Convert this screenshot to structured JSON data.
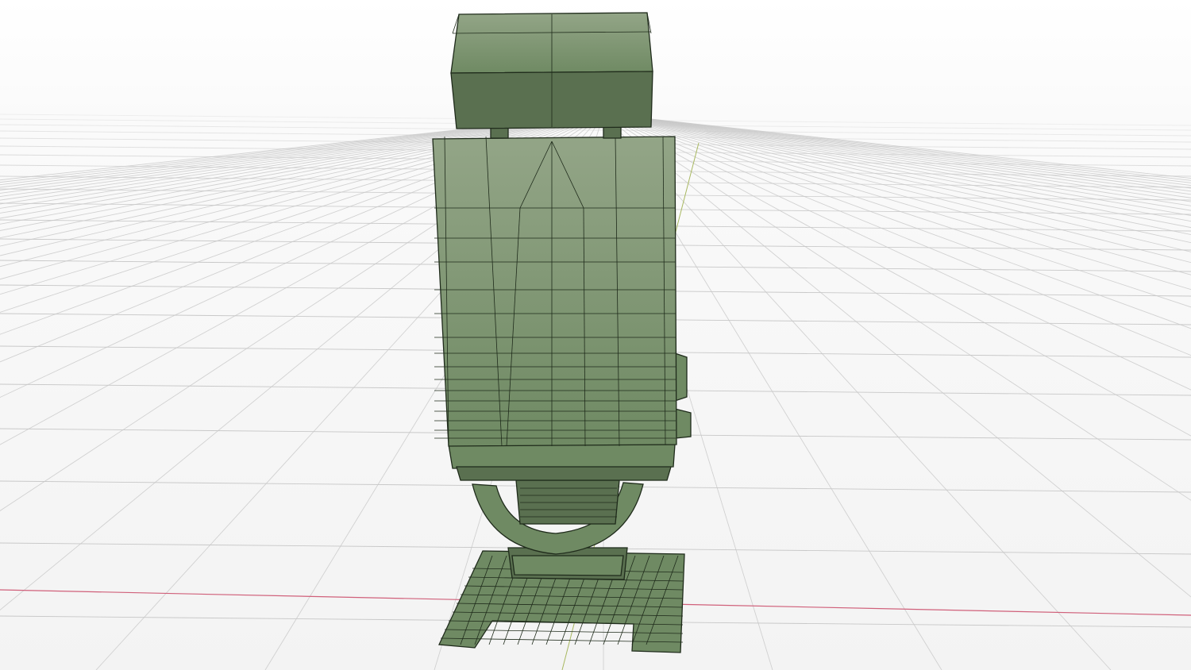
{
  "viewport": {
    "background_color": "#f6f6f6",
    "grid_color": "#c8c8c8",
    "x_axis_color": "#d0607a",
    "y_axis_color": "#a8b860"
  },
  "model": {
    "fill_color": "#6f8a63",
    "highlight_color": "#93a587",
    "shadow_color": "#5a7050",
    "wire_color": "#1f2b1b"
  }
}
